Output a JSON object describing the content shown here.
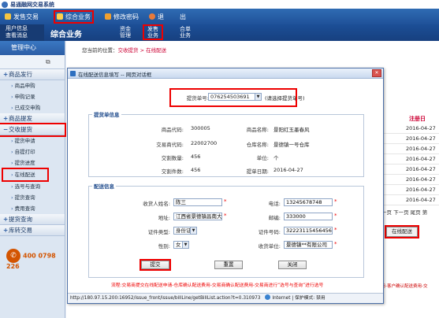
{
  "app": {
    "title": "易通融网交易系统"
  },
  "topnav": {
    "items": [
      {
        "label": "发售交易",
        "icon": "yen-icon"
      },
      {
        "label": "综合业务",
        "icon": "star-icon"
      },
      {
        "label": "修改密码",
        "icon": "edit-icon"
      },
      {
        "label": "退",
        "icon": "power-icon"
      },
      {
        "label": "出",
        "icon": ""
      }
    ]
  },
  "subnav": {
    "user_info": "用户信息",
    "view_messages": "查看消息",
    "section_title": "综合业务",
    "items": [
      {
        "line1": "资金",
        "line2": "管理"
      },
      {
        "line1": "发售",
        "line2": "业务"
      },
      {
        "line1": "合单",
        "line2": "业务"
      }
    ]
  },
  "sidebar": {
    "header": "管理中心",
    "groups": [
      {
        "label": "商品发行",
        "sign": "+",
        "children": []
      },
      {
        "label": "商品申购",
        "sign": "",
        "children": []
      },
      {
        "label": "申购记录",
        "sign": "",
        "children": []
      },
      {
        "label": "已成交申购",
        "sign": "",
        "children": []
      },
      {
        "label": "商品提发",
        "sign": "+",
        "children": []
      },
      {
        "label": "交收提货",
        "sign": "−",
        "children": [
          "提货申请",
          "自提打印",
          "提货进度",
          "在线配送",
          "选号与查询",
          "提货查询",
          "费用查询"
        ]
      },
      {
        "label": "提货查询",
        "sign": "+",
        "children": []
      },
      {
        "label": "库转交易",
        "sign": "+",
        "children": []
      }
    ],
    "phone": "400 0798 226"
  },
  "content": {
    "breadcrumb_prefix": "您当前的位置：",
    "breadcrumb_path": "交收提货 > 在线配送",
    "bg_header": "注册日",
    "bg_dates": [
      "2016-04-27",
      "2016-04-27",
      "2016-04-27",
      "2016-04-27",
      "2016-04-27",
      "2016-04-27",
      "2016-04-27",
      "2016-04-27"
    ],
    "bg_pagination": "一页 下一页 尾页 第",
    "bg_button": "在线配送",
    "bg_note": "费用-客户确认配送费用-交"
  },
  "popup": {
    "title": "在线配送信息填写 -- 网页对话框",
    "bill_label": "提货单号:",
    "bill_value": "076254503691",
    "bill_hint": "(请选择提货单号)",
    "goods_section": "提货单信息",
    "goods": {
      "code_label": "商品代码:",
      "code_value": "300005",
      "name_label": "商品名称:",
      "name_value": "景阳红玉墨春风",
      "deal_label": "交易商代码:",
      "deal_value": "22002700",
      "warehouse_label": "仓库名称:",
      "warehouse_value": "景德镇一号仓库",
      "qty_label": "交割数量:",
      "qty_value": "456",
      "unit_label": "单位:",
      "unit_value": "个",
      "apply_label": "交割件数:",
      "apply_value": "456",
      "date_label": "提单日期:",
      "date_value": "2016-04-27"
    },
    "delivery_section": "配送信息",
    "delivery": {
      "receiver_label": "收货人姓名:",
      "receiver_value": "陈三",
      "phone_label": "电话:",
      "phone_value": "13245678748",
      "address_label": "地址:",
      "address_value": "江西省景德镇昌南大道88号",
      "zip_label": "邮编:",
      "zip_value": "333000",
      "idtype_label": "证件类型:",
      "idtype_value": "身份证",
      "idno_label": "证件号码:",
      "idno_value": "32223115456456",
      "gender_label": "性别:",
      "gender_value": "女",
      "company_label": "收货单位:",
      "company_value": "景德镇**有限公司"
    },
    "buttons": {
      "submit": "提交",
      "reset": "重置",
      "close": "关闭"
    },
    "flow_note": "流程:交易商提交在线配送申请-仓库确认配送费用-交易商确认配送费用-交易商进行“选号与查询”进行选号",
    "status_url": "http://180.97.15.200:16952/issue_front/issue/billLine/getBillList.action?t=0.310973",
    "status_zone": "Internet | 保护模式: 禁用"
  },
  "colors": {
    "nav_blue": "#2f6cb3",
    "highlight_red": "#ee0000",
    "date_red": "#cc0033"
  }
}
